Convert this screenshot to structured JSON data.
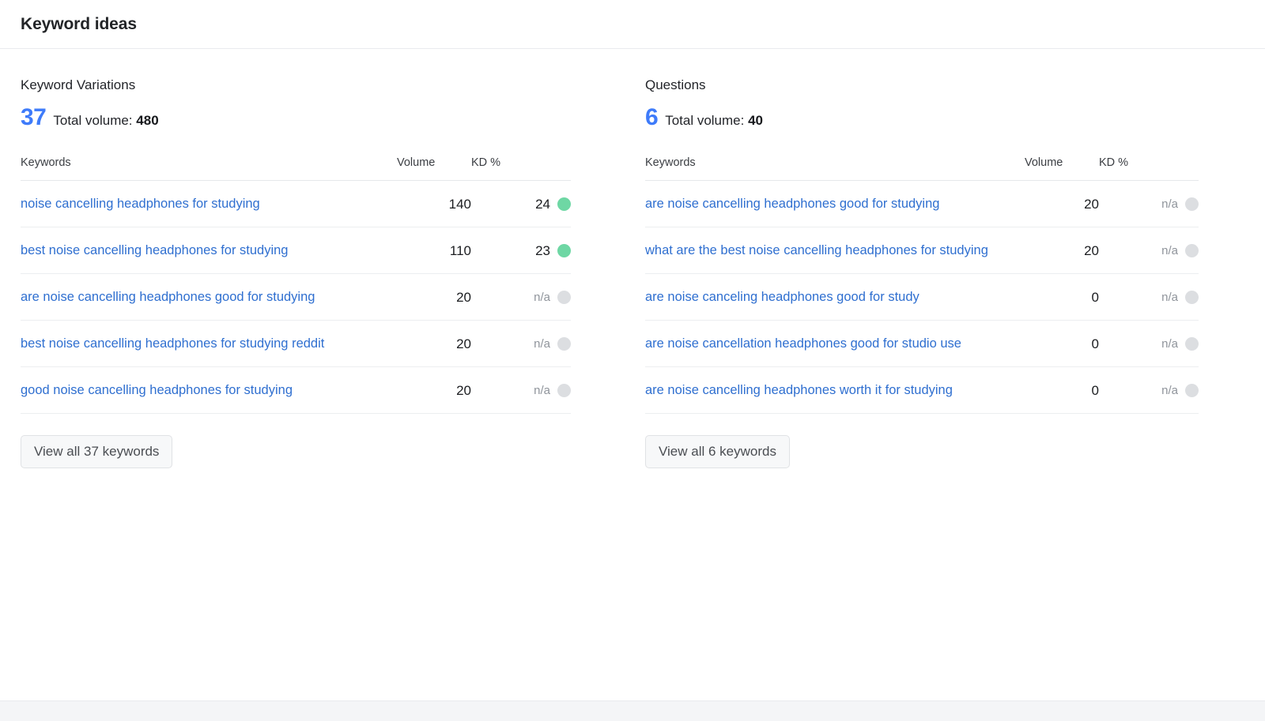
{
  "header": {
    "title": "Keyword ideas"
  },
  "columns": {
    "variations": {
      "block_title": "Keyword Variations",
      "count": "37",
      "total_volume_label": "Total volume:",
      "total_volume_value": "480",
      "table": {
        "headers": {
          "keyword": "Keywords",
          "volume": "Volume",
          "kd": "KD %"
        },
        "rows": [
          {
            "keyword": "noise cancelling headphones for studying",
            "volume": "140",
            "kd": "24",
            "kd_color": "#6ed7a4"
          },
          {
            "keyword": "best noise cancelling headphones for studying",
            "volume": "110",
            "kd": "23",
            "kd_color": "#6ed7a4"
          },
          {
            "keyword": "are noise cancelling headphones good for studying",
            "volume": "20",
            "kd": "n/a",
            "kd_color": "#dcdee1"
          },
          {
            "keyword": "best noise cancelling headphones for studying reddit",
            "volume": "20",
            "kd": "n/a",
            "kd_color": "#dcdee1"
          },
          {
            "keyword": "good noise cancelling headphones for studying",
            "volume": "20",
            "kd": "n/a",
            "kd_color": "#dcdee1"
          }
        ]
      },
      "view_all_label": "View all 37 keywords"
    },
    "questions": {
      "block_title": "Questions",
      "count": "6",
      "total_volume_label": "Total volume:",
      "total_volume_value": "40",
      "table": {
        "headers": {
          "keyword": "Keywords",
          "volume": "Volume",
          "kd": "KD %"
        },
        "rows": [
          {
            "keyword": "are noise cancelling headphones good for studying",
            "volume": "20",
            "kd": "n/a",
            "kd_color": "#dcdee1"
          },
          {
            "keyword": "what are the best noise cancelling headphones for studying",
            "volume": "20",
            "kd": "n/a",
            "kd_color": "#dcdee1"
          },
          {
            "keyword": "are noise canceling headphones good for study",
            "volume": "0",
            "kd": "n/a",
            "kd_color": "#dcdee1"
          },
          {
            "keyword": "are noise cancellation headphones good for studio use",
            "volume": "0",
            "kd": "n/a",
            "kd_color": "#dcdee1"
          },
          {
            "keyword": "are noise cancelling headphones worth it for studying",
            "volume": "0",
            "kd": "n/a",
            "kd_color": "#dcdee1"
          }
        ]
      },
      "view_all_label": "View all 6 keywords"
    }
  },
  "theme": {
    "accent_blue": "#3e7bfa",
    "link_blue": "#2f6fd0",
    "kd_green": "#6ed7a4",
    "kd_gray": "#dcdee1",
    "page_bg": "#f4f5f7",
    "card_bg": "#ffffff"
  }
}
